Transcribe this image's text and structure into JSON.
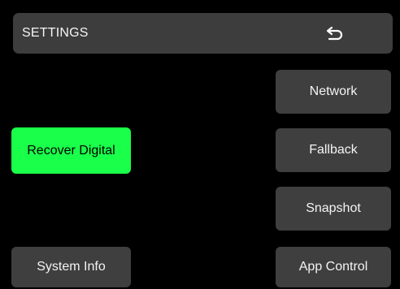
{
  "header": {
    "title": "SETTINGS",
    "back_icon": "undo-arrow-icon"
  },
  "menu": {
    "network": "Network",
    "fallback": "Fallback",
    "snapshot": "Snapshot",
    "app_control": "App Control",
    "recover_digital": "Recover Digital",
    "system_info": "System Info"
  },
  "colors": {
    "background": "#000000",
    "panel": "#3f3f3f",
    "active": "#19ff4a",
    "text": "#f4f4f4"
  }
}
